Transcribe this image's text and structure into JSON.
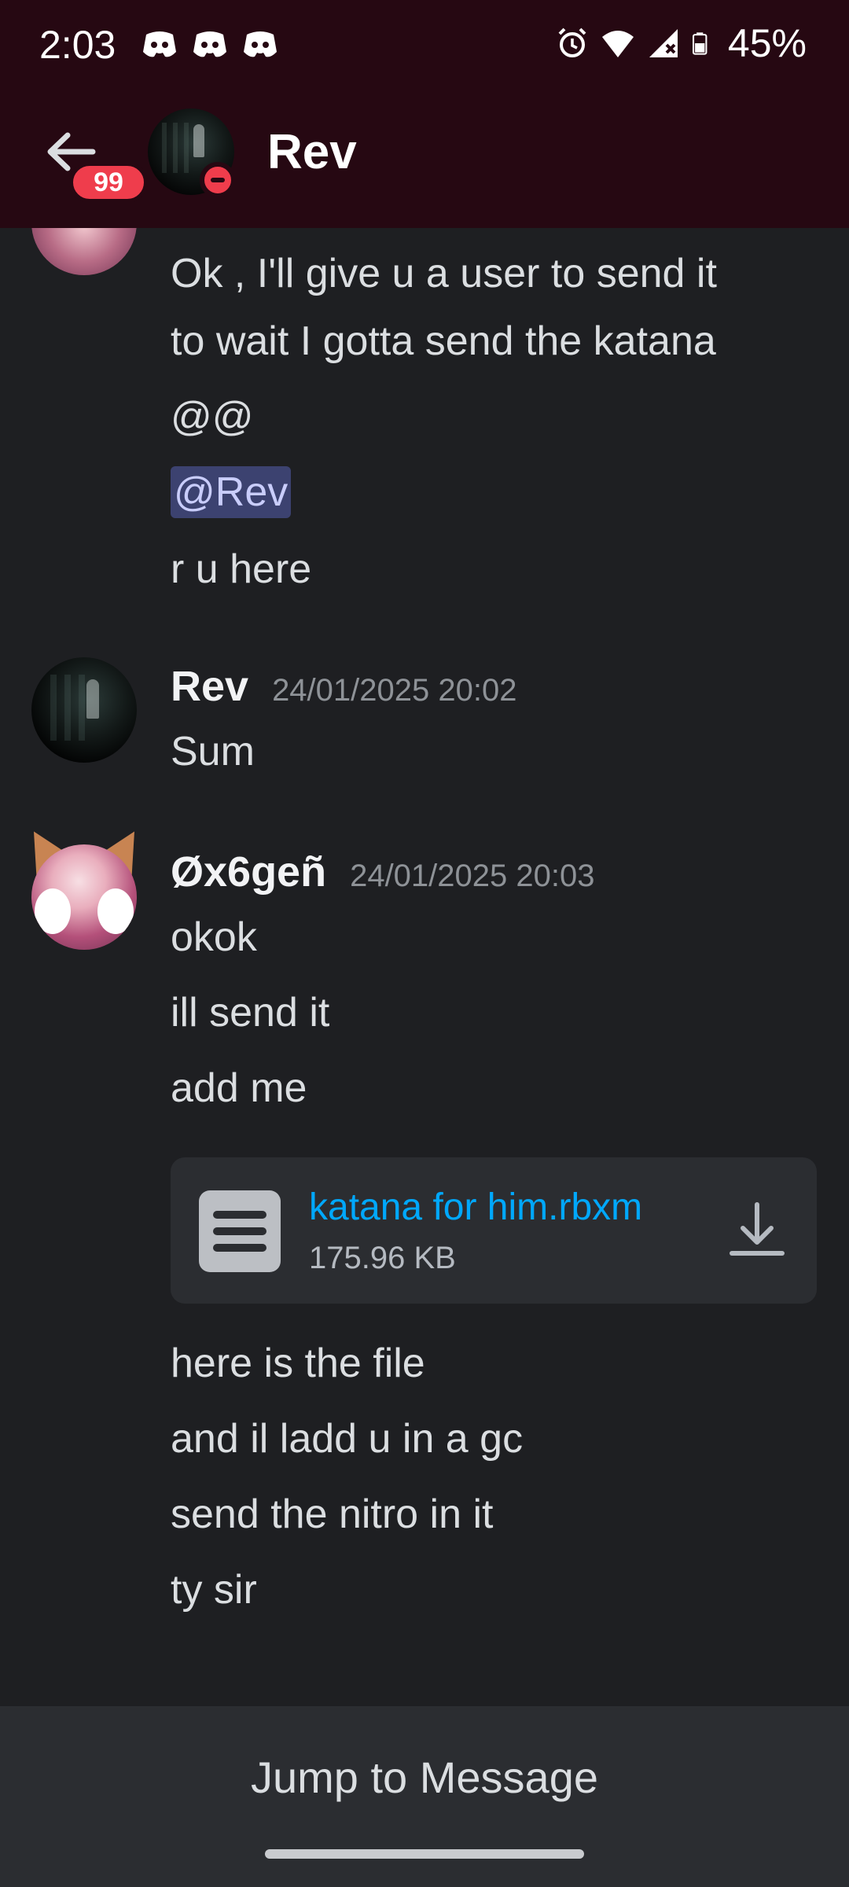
{
  "status_bar": {
    "time": "2:03",
    "battery": "45%",
    "icons": [
      "discord-icon",
      "discord-icon",
      "discord-icon",
      "alarm-icon",
      "wifi-icon",
      "signal-icon",
      "battery-icon"
    ]
  },
  "header": {
    "title": "Rev",
    "unread_badge": "99",
    "status": "do-not-disturb"
  },
  "messages": {
    "prev_lines": [
      "Ok , I'll give u a user to send it",
      "to wait I gotta send the katana",
      "@@",
      "@Rev",
      "r u here"
    ],
    "rev": {
      "author": "Rev",
      "timestamp": "24/01/2025 20:02",
      "lines": [
        "Sum"
      ]
    },
    "ox": {
      "author": "Øx6geñ",
      "timestamp": "24/01/2025 20:03",
      "lines_before": [
        "okok",
        "ill send it",
        "add me"
      ],
      "attachment": {
        "name": "katana for him.rbxm",
        "size": "175.96 KB"
      },
      "lines_after": [
        "here is the file",
        "and il ladd u in a gc",
        "send the nitro in it",
        "ty sir"
      ]
    }
  },
  "footer": {
    "jump_label": "Jump to Message"
  },
  "colors": {
    "header_bg": "#260812",
    "chat_bg": "#1e1f22",
    "link": "#00a8fc",
    "mention_bg": "#3c4270",
    "badge": "#ef3d4c"
  }
}
